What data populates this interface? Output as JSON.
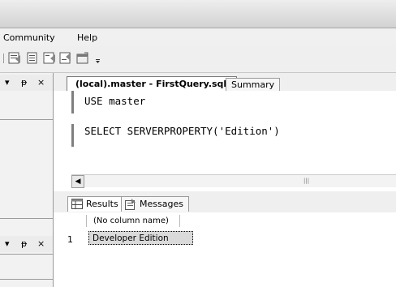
{
  "menu": {
    "items": [
      "Community",
      "Help"
    ]
  },
  "toolbar": {
    "icons": [
      "query-icon",
      "results-to-text-icon",
      "results-to-grid-icon",
      "results-to-file-icon",
      "properties-icon",
      "toolbar-options-icon"
    ]
  },
  "left_panes": {
    "top": {
      "controls": [
        "▾",
        "ᵽ",
        "×"
      ]
    },
    "bottom": {
      "controls": [
        "▾",
        "ᵽ",
        "×"
      ]
    }
  },
  "document_tabs": [
    {
      "label": "(local).master - FirstQuery.sql*",
      "active": true
    },
    {
      "label": "Summary",
      "active": false
    }
  ],
  "editor": {
    "lines": [
      "USE master",
      "",
      "SELECT SERVERPROPERTY('Edition')"
    ]
  },
  "results_tabs": [
    {
      "label": "Results",
      "active": true
    },
    {
      "label": "Messages",
      "active": false
    }
  ],
  "results_grid": {
    "columns": [
      "(No column name)"
    ],
    "rows": [
      {
        "row_number": "1",
        "values": [
          "Developer Edition"
        ]
      }
    ]
  },
  "colors": {
    "accent": "#000000"
  }
}
